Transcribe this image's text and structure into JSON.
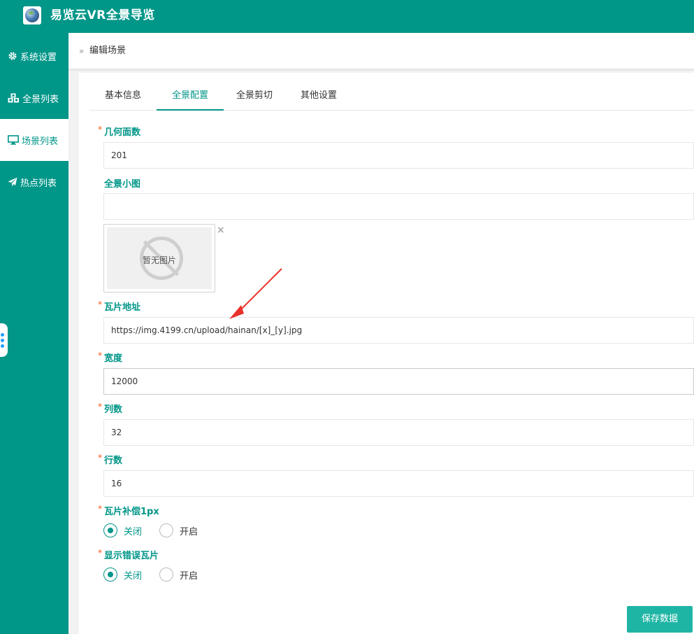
{
  "app": {
    "title": "易览云VR全景导览"
  },
  "sidebar": {
    "items": [
      {
        "label": "系统设置",
        "icon": "gear-icon"
      },
      {
        "label": "全景列表",
        "icon": "cubes-icon"
      },
      {
        "label": "场景列表",
        "icon": "monitor-icon",
        "active": true
      },
      {
        "label": "热点列表",
        "icon": "paper-plane-icon"
      }
    ]
  },
  "breadcrumb": {
    "separator": "»",
    "current": "编辑场景"
  },
  "tabs": [
    {
      "label": "基本信息"
    },
    {
      "label": "全景配置",
      "active": true
    },
    {
      "label": "全景剪切"
    },
    {
      "label": "其他设置"
    }
  ],
  "form": {
    "required_mark": "*",
    "geometry": {
      "label": "几何面数",
      "value": "201"
    },
    "thumbnail": {
      "label": "全景小图",
      "value": "",
      "no_image_text": "暂无图片",
      "remove_symbol": "×"
    },
    "tile_url": {
      "label": "瓦片地址",
      "value": "https://img.4199.cn/upload/hainan/[x]_[y].jpg"
    },
    "width": {
      "label": "宽度",
      "value": "12000"
    },
    "columns": {
      "label": "列数",
      "value": "32"
    },
    "rows": {
      "label": "行数",
      "value": "16"
    },
    "tile_compensation": {
      "label": "瓦片补偿1px",
      "options": [
        "关闭",
        "开启"
      ],
      "selected": "关闭"
    },
    "show_error_tiles": {
      "label": "显示错误瓦片",
      "options": [
        "关闭",
        "开启"
      ],
      "selected": "关闭"
    }
  },
  "actions": {
    "save_label": "保存数据"
  },
  "colors": {
    "primary": "#009688",
    "accent_button": "#1fb5a5",
    "required": "#ff5722",
    "annotation_arrow": "#e8322b"
  }
}
